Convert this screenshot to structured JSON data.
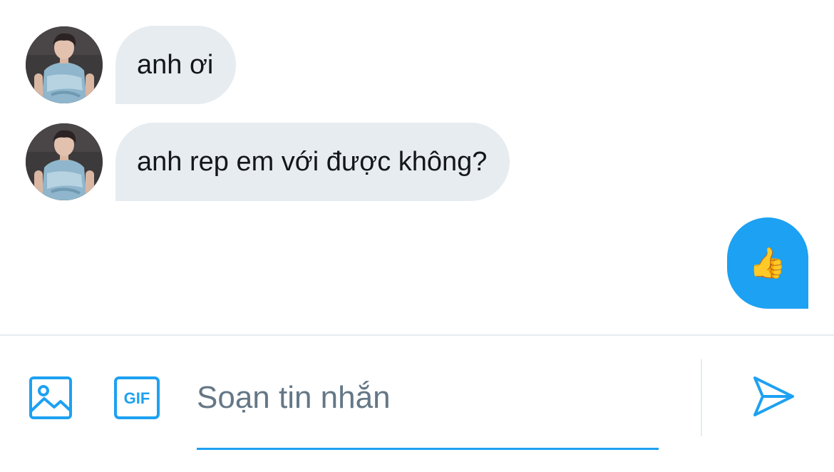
{
  "conversation": {
    "messages": [
      {
        "direction": "incoming",
        "text": "anh ơi"
      },
      {
        "direction": "incoming",
        "text": "anh rep em với được không?"
      },
      {
        "direction": "outgoing",
        "text": "👍"
      }
    ]
  },
  "composer": {
    "placeholder": "Soạn tin nhắn",
    "value": "",
    "icons": {
      "image": "image-icon",
      "gif": "gif-icon",
      "gif_label": "GIF",
      "send": "send-icon"
    }
  },
  "colors": {
    "accent": "#1da1f2",
    "incoming_bubble": "#e6ecf0",
    "text": "#14171a",
    "placeholder": "#657786",
    "divider": "#e6ecf0"
  }
}
